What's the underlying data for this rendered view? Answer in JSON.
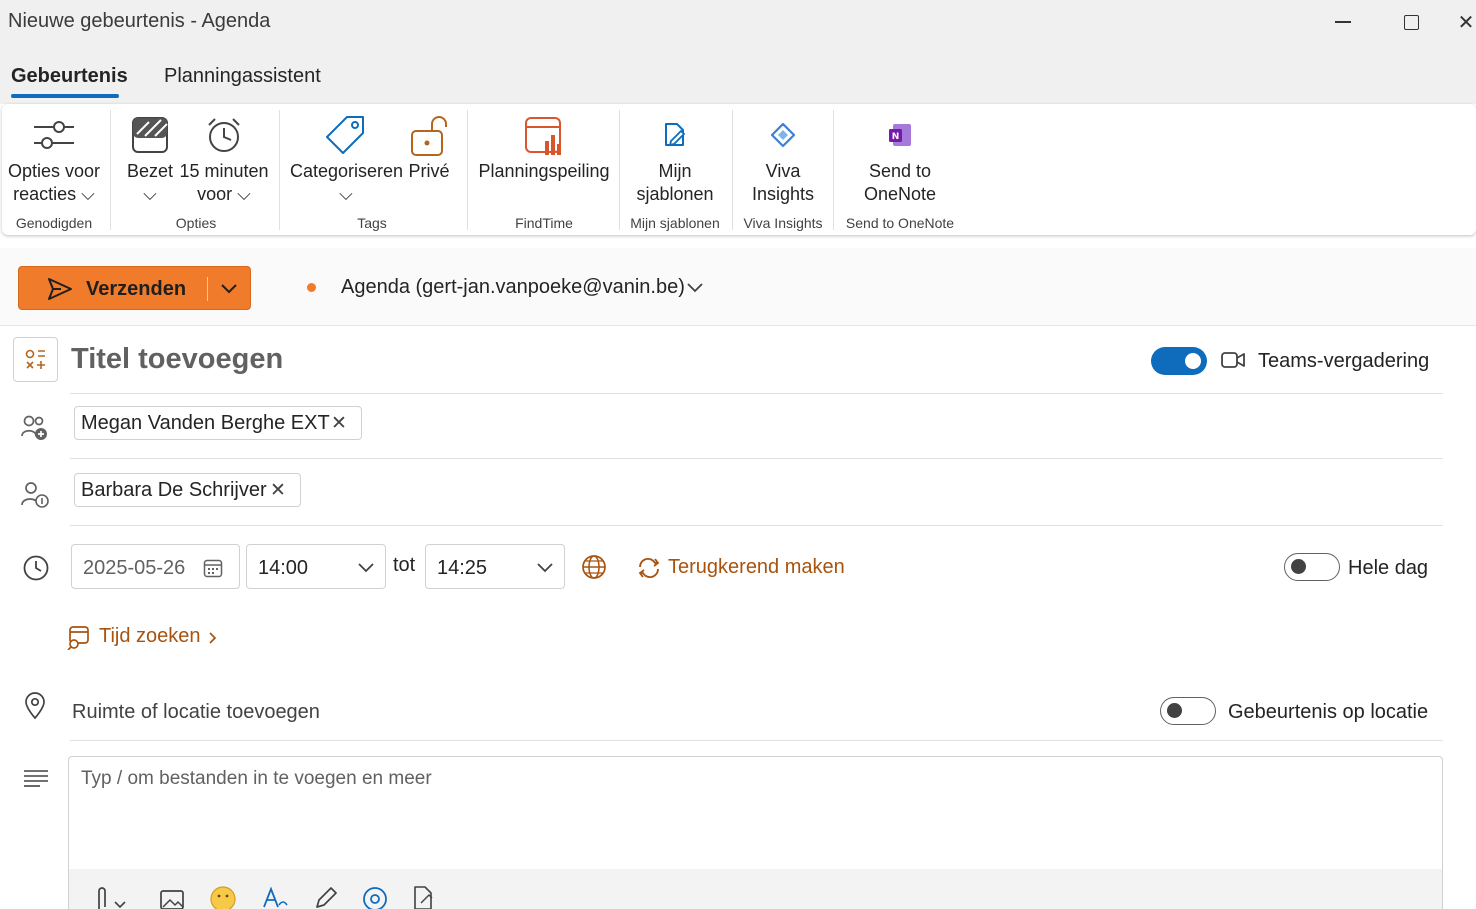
{
  "window": {
    "title": "Nieuwe gebeurtenis - Agenda"
  },
  "tabs": [
    {
      "label": "Gebeurtenis",
      "active": true
    },
    {
      "label": "Planningassistent",
      "active": false
    }
  ],
  "ribbon": {
    "groups": [
      {
        "label": "Genodigden",
        "buttons": [
          {
            "line1": "Opties voor",
            "line2": "reacties ⌵",
            "icon": "sliders-icon"
          }
        ]
      },
      {
        "label": "Opties",
        "buttons": [
          {
            "line1": "Bezet",
            "line2": "⌵",
            "icon": "busy-icon"
          },
          {
            "line1": "15 minuten",
            "line2": "voor ⌵",
            "icon": "alarm-clock-icon"
          }
        ]
      },
      {
        "label": "Tags",
        "buttons": [
          {
            "line1": "Categoriseren",
            "line2": "⌵",
            "icon": "tag-icon"
          },
          {
            "line1": "Privé",
            "line2": "",
            "icon": "lock-icon"
          }
        ]
      },
      {
        "label": "FindTime",
        "buttons": [
          {
            "line1": "Planningspeiling",
            "line2": "",
            "icon": "poll-calendar-icon"
          }
        ]
      },
      {
        "label": "Mijn sjablonen",
        "buttons": [
          {
            "line1": "Mijn",
            "line2": "sjablonen",
            "icon": "template-icon"
          }
        ]
      },
      {
        "label": "Viva Insights",
        "buttons": [
          {
            "line1": "Viva",
            "line2": "Insights",
            "icon": "viva-insights-icon"
          }
        ]
      },
      {
        "label": "Send to OneNote",
        "buttons": [
          {
            "line1": "Send to",
            "line2": "OneNote",
            "icon": "onenote-icon"
          }
        ]
      }
    ]
  },
  "send": {
    "label": "Verzenden",
    "calendar": "Agenda (gert-jan.vanpoeke@vanin.be)",
    "accent": "#ef7b2b"
  },
  "form": {
    "title_placeholder": "Titel toevoegen",
    "teams_label": "Teams-vergadering",
    "teams_enabled": true,
    "required_attendees": [
      "Megan Vanden Berghe EXT"
    ],
    "optional_attendees": [
      "Barbara De Schrijver"
    ],
    "date": "2025-05-26",
    "start_time": "14:00",
    "to_label": "tot",
    "end_time": "14:25",
    "recurring_label": "Terugkerend maken",
    "all_day_label": "Hele dag",
    "all_day_enabled": false,
    "find_time_label": "Tijd zoeken",
    "location_placeholder": "Ruimte of locatie toevoegen",
    "in_person_label": "Gebeurtenis op locatie",
    "in_person_enabled": false,
    "body_placeholder": "Typ / om bestanden in te voegen en meer"
  }
}
